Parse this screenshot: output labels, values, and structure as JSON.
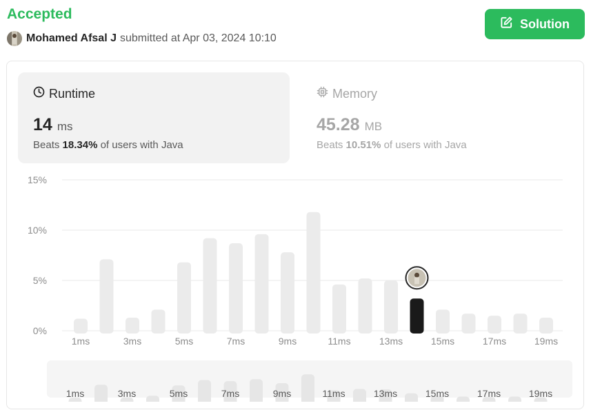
{
  "header": {
    "status": "Accepted",
    "author": "Mohamed Afsal J",
    "submitted_text": "submitted at Apr 03, 2024 10:10",
    "solution_label": "Solution"
  },
  "runtime": {
    "title": "Runtime",
    "value": "14",
    "unit": "ms",
    "beats_prefix": "Beats",
    "beats_pct": "18.34%",
    "beats_suffix": "of users with Java"
  },
  "memory": {
    "title": "Memory",
    "value": "45.28",
    "unit": "MB",
    "beats_prefix": "Beats",
    "beats_pct": "10.51%",
    "beats_suffix": "of users with Java"
  },
  "colors": {
    "accent": "#2cbb5d",
    "bar": "#ebebeb",
    "highlight": "#1a1a1a",
    "grid": "#e8e8e8",
    "tick": "#8c8c8c"
  },
  "icons": {
    "solution": "edit-icon",
    "runtime": "clock-icon",
    "memory": "chip-icon"
  },
  "chart_data": {
    "type": "bar",
    "categories": [
      "1ms",
      "2ms",
      "3ms",
      "4ms",
      "5ms",
      "6ms",
      "7ms",
      "8ms",
      "9ms",
      "10ms",
      "11ms",
      "12ms",
      "13ms",
      "14ms",
      "15ms",
      "16ms",
      "17ms",
      "18ms",
      "19ms"
    ],
    "x_tick_labels": [
      "1ms",
      "3ms",
      "5ms",
      "7ms",
      "9ms",
      "11ms",
      "13ms",
      "15ms",
      "17ms",
      "19ms"
    ],
    "y_tick_labels": [
      "0%",
      "5%",
      "10%",
      "15%"
    ],
    "values": [
      1.2,
      7.1,
      1.3,
      2.1,
      6.8,
      9.2,
      8.7,
      9.6,
      7.8,
      11.8,
      4.6,
      5.2,
      5.0,
      3.2,
      2.1,
      1.7,
      1.5,
      1.7,
      1.3
    ],
    "highlight_category": "14ms",
    "ylim": [
      0,
      15
    ],
    "grid": true,
    "mini_tick_labels": [
      "1ms",
      "3ms",
      "5ms",
      "7ms",
      "9ms",
      "11ms",
      "13ms",
      "15ms",
      "17ms",
      "19ms"
    ]
  }
}
